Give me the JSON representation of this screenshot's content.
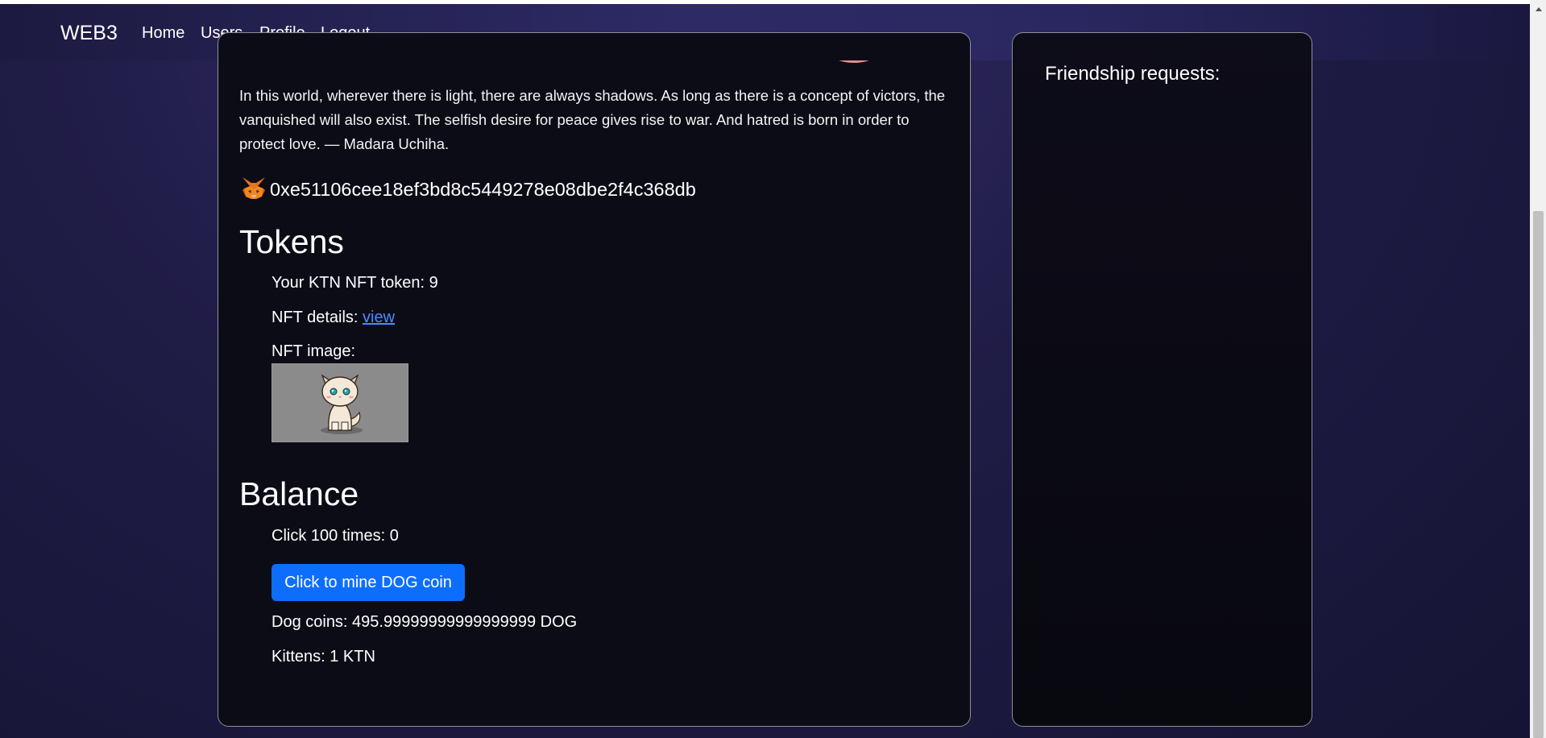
{
  "nav": {
    "brand": "WEB3",
    "links": [
      "Home",
      "Users",
      "Profile",
      "Logout"
    ]
  },
  "profile": {
    "quote": "In this world, wherever there is light, there are always shadows. As long as there is a concept of victors, the vanquished will also exist. The selfish desire for peace gives rise to war. And hatred is born in order to protect love. — Madara Uchiha.",
    "wallet_icon": "metamask-fox-icon",
    "wallet_address": "0xe51106cee18ef3bd8c5449278e08dbe2f4c368db"
  },
  "tokens": {
    "heading": "Tokens",
    "nft_token_line": "Your KTN NFT token: 9",
    "nft_details_label": "NFT details: ",
    "nft_details_link": "view",
    "nft_image_label": "NFT image:"
  },
  "balance": {
    "heading": "Balance",
    "click_count_line": "Click 100 times: 0",
    "mine_button": "Click to mine DOG coin",
    "dog_coins_line": "Dog coins: 495.99999999999999999 DOG",
    "kittens_line": "Kittens: 1 KTN"
  },
  "side": {
    "friendship_title": "Friendship requests:"
  },
  "colors": {
    "accent_button": "#0d6efd",
    "link": "#4a8cff",
    "card_bg": "#0c0c17"
  }
}
